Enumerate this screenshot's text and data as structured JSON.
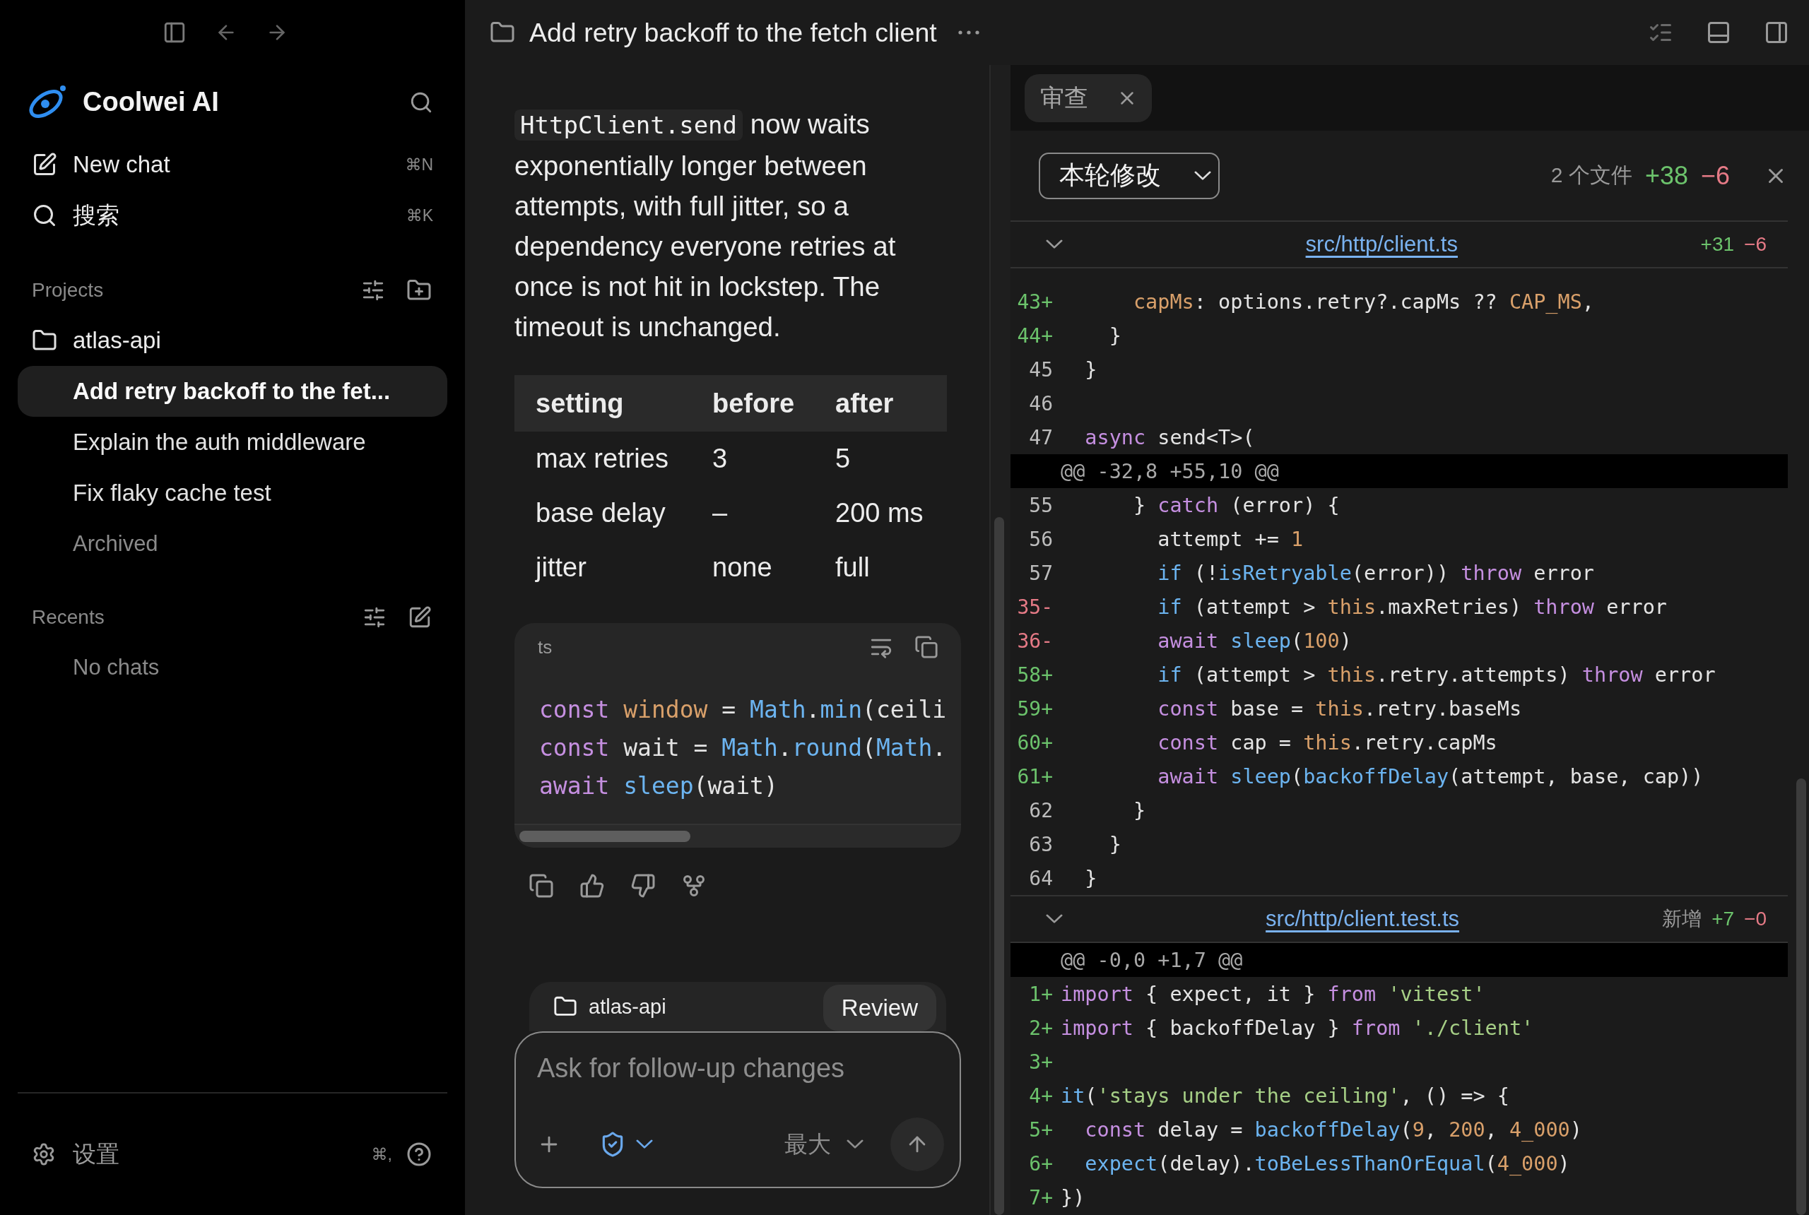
{
  "sidebar": {
    "brand": "Coolwei AI",
    "actions": [
      {
        "kind": "compose",
        "label": "New chat",
        "shortcut": "⌘N"
      },
      {
        "kind": "search",
        "label": "搜索",
        "shortcut": "⌘K"
      }
    ],
    "projects": {
      "title": "Projects",
      "folder": "atlas-api",
      "chats": [
        {
          "title": "Add retry backoff to the fet...",
          "selected": true
        },
        {
          "title": "Explain the auth middleware",
          "selected": false
        },
        {
          "title": "Fix flaky cache test",
          "selected": false
        }
      ],
      "archived": "Archived"
    },
    "recents": {
      "title": "Recents",
      "empty": "No chats"
    },
    "settings": {
      "label": "设置",
      "shortcut": "⌘,"
    }
  },
  "title_bar": {
    "title": "Add retry backoff to the fetch client"
  },
  "chat": {
    "paragraph": {
      "code": "HttpClient.send",
      "text": " now waits exponentially longer between attempts, with full jitter, so a dependency everyone retries at once is not hit in lockstep. The timeout is unchanged."
    },
    "table": {
      "columns": [
        "setting",
        "before",
        "after"
      ],
      "rows": [
        [
          "max retries",
          "3",
          "5"
        ],
        [
          "base delay",
          "–",
          "200 ms"
        ],
        [
          "jitter",
          "none",
          "full"
        ]
      ]
    },
    "code_block": {
      "language": "ts",
      "lines": [
        [
          {
            "kind": "keyword",
            "text": "const "
          },
          {
            "kind": "value",
            "text": "window"
          },
          {
            "kind": "plain",
            "text": " = "
          },
          {
            "kind": "call",
            "text": "Math"
          },
          {
            "kind": "plain",
            "text": "."
          },
          {
            "kind": "call",
            "text": "min"
          },
          {
            "kind": "plain",
            "text": "(ceili"
          }
        ],
        [
          {
            "kind": "keyword",
            "text": "const "
          },
          {
            "kind": "plain",
            "text": "wait = "
          },
          {
            "kind": "call",
            "text": "Math"
          },
          {
            "kind": "plain",
            "text": "."
          },
          {
            "kind": "call",
            "text": "round"
          },
          {
            "kind": "plain",
            "text": "("
          },
          {
            "kind": "call",
            "text": "Math"
          },
          {
            "kind": "plain",
            "text": "."
          }
        ],
        [
          {
            "kind": "keyword",
            "text": "await "
          },
          {
            "kind": "call",
            "text": "sleep"
          },
          {
            "kind": "plain",
            "text": "(wait)"
          }
        ]
      ]
    },
    "composer": {
      "project": "atlas-api",
      "mode": "Review",
      "placeholder": "Ask for follow-up changes",
      "effort": "最大"
    }
  },
  "review": {
    "tabs": [
      {
        "label": "审查",
        "selected": true
      }
    ],
    "scope": "本轮修改",
    "summary": {
      "files": "2 个文件",
      "added": "+38",
      "removed": "−6"
    },
    "files": [
      {
        "path": "src/http/client.ts",
        "added": "+31",
        "removed": "−6",
        "lines": [
          {
            "kind": "added",
            "num": "43+",
            "tokens": [
              {
                "kind": "value",
                "text": "      capMs"
              },
              {
                "kind": "plain",
                "text": ": options.retry?.capMs ?? "
              },
              {
                "kind": "value",
                "text": "CAP_MS"
              },
              {
                "kind": "plain",
                "text": ","
              }
            ]
          },
          {
            "kind": "added",
            "num": "44+",
            "tokens": [
              {
                "kind": "plain",
                "text": "    }"
              }
            ]
          },
          {
            "kind": "context",
            "num": "45",
            "tokens": [
              {
                "kind": "plain",
                "text": "  }"
              }
            ]
          },
          {
            "kind": "context",
            "num": "46"
          },
          {
            "kind": "context",
            "num": "47",
            "tokens": [
              {
                "kind": "keyword",
                "text": "  async"
              },
              {
                "kind": "plain",
                "text": " send<T>("
              }
            ]
          },
          {
            "kind": "hunk",
            "text": "@@ -32,8 +55,10 @@"
          },
          {
            "kind": "context",
            "num": "55",
            "tokens": [
              {
                "kind": "plain",
                "text": "      } "
              },
              {
                "kind": "keyword",
                "text": "catch"
              },
              {
                "kind": "plain",
                "text": " (error) {"
              }
            ]
          },
          {
            "kind": "context",
            "num": "56",
            "tokens": [
              {
                "kind": "plain",
                "text": "        attempt += "
              },
              {
                "kind": "value",
                "text": "1"
              }
            ]
          },
          {
            "kind": "context",
            "num": "57",
            "tokens": [
              {
                "kind": "call",
                "text": "        if"
              },
              {
                "kind": "plain",
                "text": " (!"
              },
              {
                "kind": "call",
                "text": "isRetryable"
              },
              {
                "kind": "plain",
                "text": "(error)) "
              },
              {
                "kind": "keyword",
                "text": "throw"
              },
              {
                "kind": "plain",
                "text": " error"
              }
            ]
          },
          {
            "kind": "removed",
            "num": "35-",
            "tokens": [
              {
                "kind": "call",
                "text": "        if"
              },
              {
                "kind": "plain",
                "text": " (attempt > "
              },
              {
                "kind": "value",
                "text": "this"
              },
              {
                "kind": "plain",
                "text": ".maxRetries) "
              },
              {
                "kind": "keyword",
                "text": "throw"
              },
              {
                "kind": "plain",
                "text": " error"
              }
            ]
          },
          {
            "kind": "removed",
            "num": "36-",
            "tokens": [
              {
                "kind": "keyword",
                "text": "        await "
              },
              {
                "kind": "call",
                "text": "sleep"
              },
              {
                "kind": "plain",
                "text": "("
              },
              {
                "kind": "value",
                "text": "100"
              },
              {
                "kind": "plain",
                "text": ")"
              }
            ]
          },
          {
            "kind": "added",
            "num": "58+",
            "tokens": [
              {
                "kind": "call",
                "text": "        if"
              },
              {
                "kind": "plain",
                "text": " (attempt > "
              },
              {
                "kind": "value",
                "text": "this"
              },
              {
                "kind": "plain",
                "text": ".retry.attempts) "
              },
              {
                "kind": "keyword",
                "text": "throw"
              },
              {
                "kind": "plain",
                "text": " error"
              }
            ]
          },
          {
            "kind": "added",
            "num": "59+",
            "tokens": [
              {
                "kind": "keyword",
                "text": "        const"
              },
              {
                "kind": "plain",
                "text": " base = "
              },
              {
                "kind": "value",
                "text": "this"
              },
              {
                "kind": "plain",
                "text": ".retry.baseMs"
              }
            ]
          },
          {
            "kind": "added",
            "num": "60+",
            "tokens": [
              {
                "kind": "keyword",
                "text": "        const"
              },
              {
                "kind": "plain",
                "text": " cap = "
              },
              {
                "kind": "value",
                "text": "this"
              },
              {
                "kind": "plain",
                "text": ".retry.capMs"
              }
            ]
          },
          {
            "kind": "added",
            "num": "61+",
            "tokens": [
              {
                "kind": "keyword",
                "text": "        await "
              },
              {
                "kind": "call",
                "text": "sleep"
              },
              {
                "kind": "plain",
                "text": "("
              },
              {
                "kind": "call",
                "text": "backoffDelay"
              },
              {
                "kind": "plain",
                "text": "(attempt, base, cap))"
              }
            ]
          },
          {
            "kind": "context",
            "num": "62",
            "tokens": [
              {
                "kind": "plain",
                "text": "      }"
              }
            ]
          },
          {
            "kind": "context",
            "num": "63",
            "tokens": [
              {
                "kind": "plain",
                "text": "    }"
              }
            ]
          },
          {
            "kind": "context",
            "num": "64",
            "tokens": [
              {
                "kind": "plain",
                "text": "  }"
              }
            ]
          }
        ]
      },
      {
        "path": "src/http/client.test.ts",
        "status": "新增",
        "added": "+7",
        "removed": "−0",
        "lines": [
          {
            "kind": "hunk",
            "text": "@@ -0,0 +1,7 @@"
          },
          {
            "kind": "added",
            "num": "1+",
            "tokens": [
              {
                "kind": "keyword",
                "text": "import"
              },
              {
                "kind": "plain",
                "text": " { expect, it } "
              },
              {
                "kind": "keyword",
                "text": "from "
              },
              {
                "kind": "string",
                "text": "'vitest'"
              }
            ]
          },
          {
            "kind": "added",
            "num": "2+",
            "tokens": [
              {
                "kind": "keyword",
                "text": "import"
              },
              {
                "kind": "plain",
                "text": " { backoffDelay } "
              },
              {
                "kind": "keyword",
                "text": "from "
              },
              {
                "kind": "string",
                "text": "'./client'"
              }
            ]
          },
          {
            "kind": "added",
            "num": "3+"
          },
          {
            "kind": "added",
            "num": "4+",
            "tokens": [
              {
                "kind": "call",
                "text": "it"
              },
              {
                "kind": "plain",
                "text": "("
              },
              {
                "kind": "string",
                "text": "'stays under the ceiling'"
              },
              {
                "kind": "plain",
                "text": ", () => {"
              }
            ]
          },
          {
            "kind": "added",
            "num": "5+",
            "tokens": [
              {
                "kind": "keyword",
                "text": "  const"
              },
              {
                "kind": "plain",
                "text": " delay = "
              },
              {
                "kind": "call",
                "text": "backoffDelay"
              },
              {
                "kind": "plain",
                "text": "("
              },
              {
                "kind": "value",
                "text": "9"
              },
              {
                "kind": "plain",
                "text": ", "
              },
              {
                "kind": "value",
                "text": "200"
              },
              {
                "kind": "plain",
                "text": ", "
              },
              {
                "kind": "value",
                "text": "4_000"
              },
              {
                "kind": "plain",
                "text": ")"
              }
            ]
          },
          {
            "kind": "added",
            "num": "6+",
            "tokens": [
              {
                "kind": "call",
                "text": "  expect"
              },
              {
                "kind": "plain",
                "text": "(delay)."
              },
              {
                "kind": "call",
                "text": "toBeLessThanOrEqual"
              },
              {
                "kind": "plain",
                "text": "("
              },
              {
                "kind": "value",
                "text": "4_000"
              },
              {
                "kind": "plain",
                "text": ")"
              }
            ]
          },
          {
            "kind": "added",
            "num": "7+",
            "tokens": [
              {
                "kind": "plain",
                "text": "})"
              }
            ]
          }
        ]
      }
    ]
  }
}
